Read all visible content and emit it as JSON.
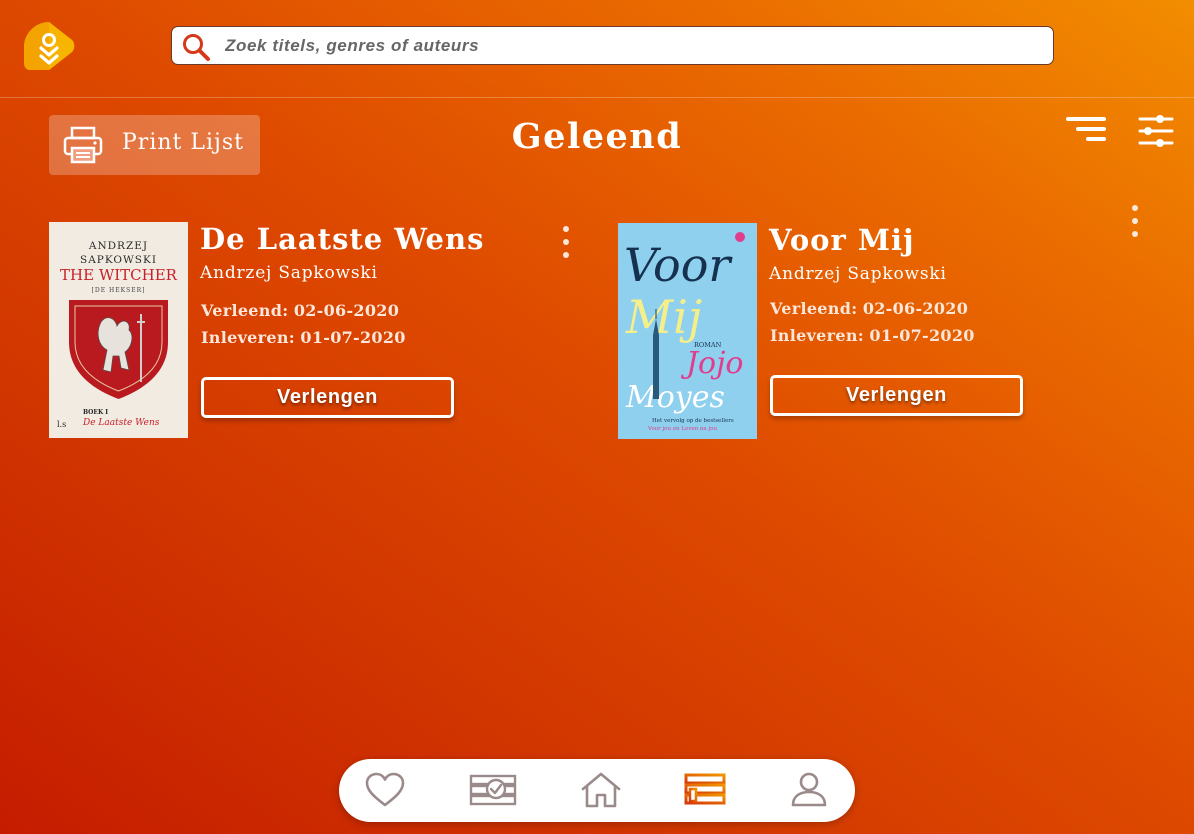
{
  "app": {
    "logo_icon": "app-logo-icon"
  },
  "search": {
    "placeholder": "Zoek titels, genres of auteurs",
    "value": "",
    "icon": "search-icon"
  },
  "header": {
    "print_label": "Print Lijst",
    "print_icon": "printer-icon",
    "title": "Geleend",
    "sort_icon": "sort-icon",
    "filter_icon": "filter-sliders-icon"
  },
  "loans": [
    {
      "title": "De Laatste Wens",
      "author": "Andrzej Sapkowski",
      "loaned_label": "Verleend:",
      "loaned_date": "02-06-2020",
      "due_label": "Inleveren:",
      "due_date": "01-07-2020",
      "button_label": "Verlengen",
      "cover": {
        "author_line1": "ANDRZEJ",
        "author_line2": "SAPKOWSKI",
        "series": "THE WITCHER",
        "subtitle": "[DE HEKSER]",
        "book_no": "BOEK I",
        "book_title": "De Laatste Wens",
        "publisher": "l.s"
      }
    },
    {
      "title": "Voor Mij",
      "author": "Andrzej Sapkowski",
      "loaned_label": "Verleend:",
      "loaned_date": "02-06-2020",
      "due_label": "Inleveren:",
      "due_date": "01-07-2020",
      "button_label": "Verlengen",
      "cover": {
        "word1": "Voor",
        "word2": "Mij",
        "genre": "ROMAN",
        "author_first": "Jojo",
        "author_last": "Moyes",
        "tagline": "Het vervolg op de bestsellers",
        "tagline2": "Voor jou en Leven na jou"
      }
    }
  ],
  "nav": {
    "items": [
      {
        "icon": "heart-icon"
      },
      {
        "icon": "reserved-books-icon"
      },
      {
        "icon": "home-icon"
      },
      {
        "icon": "borrowed-books-icon",
        "active": true
      },
      {
        "icon": "user-icon"
      }
    ]
  },
  "colors": {
    "gradient_start": "#f28d00",
    "gradient_end": "#c51c00",
    "active_nav": "#e2620a",
    "inactive_nav": "#9a8a8a",
    "search_icon": "#d6391a"
  }
}
